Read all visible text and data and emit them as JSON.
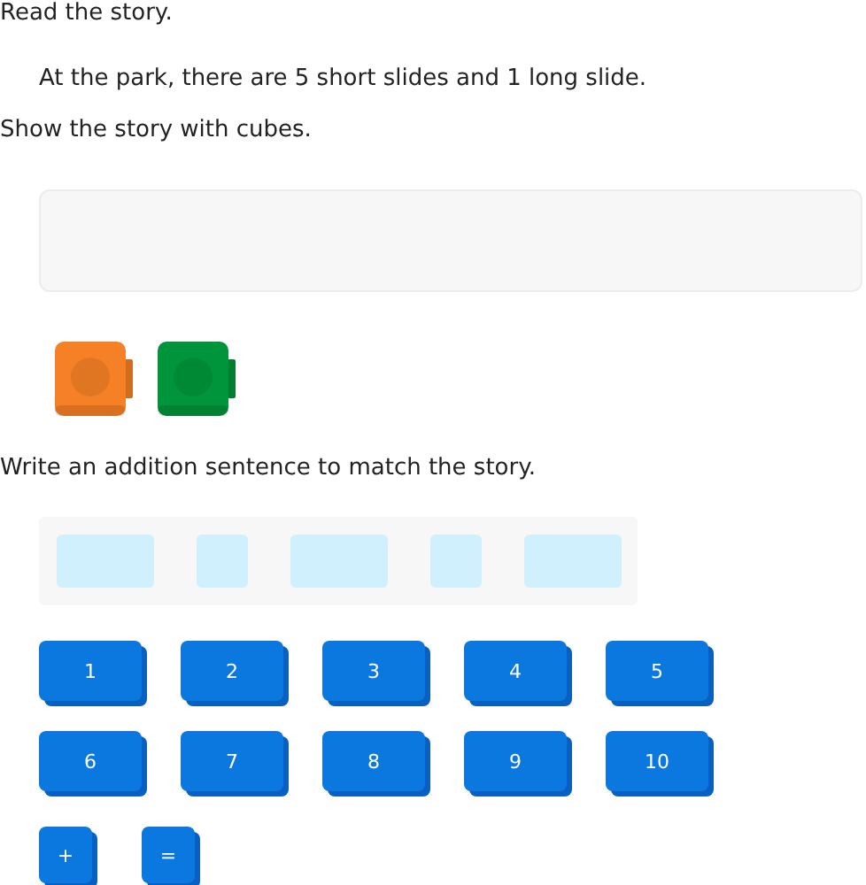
{
  "instruction": "Read the story.",
  "story": "At the park, there are 5 short slides and 1 long slide.",
  "prompt": "Show the story with cubes.",
  "cubes": [
    {
      "color": "#f58025"
    },
    {
      "color": "#00953a"
    }
  ],
  "prompt_2": "Write an addition sentence to match the story.",
  "answer_slots": [
    {
      "kind": "wide"
    },
    {
      "kind": "narrow"
    },
    {
      "kind": "wide"
    },
    {
      "kind": "narrow"
    },
    {
      "kind": "wide"
    }
  ],
  "number_tiles": [
    "1",
    "2",
    "3",
    "4",
    "5",
    "6",
    "7",
    "8",
    "9",
    "10"
  ],
  "symbol_tiles": [
    "+",
    "="
  ]
}
